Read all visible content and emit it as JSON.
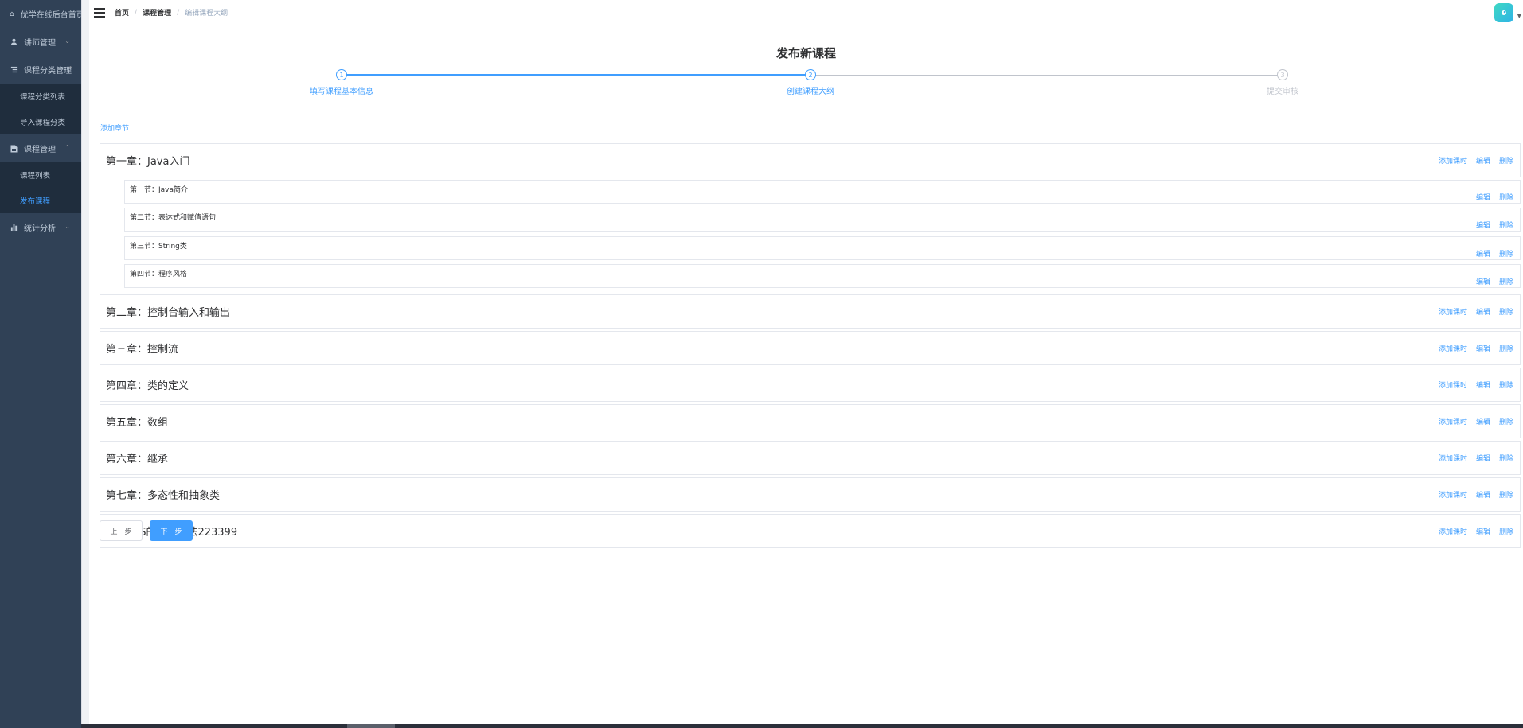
{
  "sidebar": {
    "items": [
      {
        "label": "优学在线后台首页",
        "icon": "home-icon"
      },
      {
        "label": "讲师管理",
        "icon": "user-icon"
      },
      {
        "label": "课程分类管理",
        "icon": "list-icon"
      },
      {
        "label": "课程管理",
        "icon": "document-icon"
      },
      {
        "label": "统计分析",
        "icon": "bar-chart-icon"
      }
    ],
    "category_sub": [
      "课程分类列表",
      "导入课程分类"
    ],
    "course_sub": [
      "课程列表",
      "发布课程"
    ]
  },
  "breadcrumb": [
    "首页",
    "课程管理",
    "编辑课程大纲"
  ],
  "page_title": "发布新课程",
  "steps": [
    {
      "num": "1",
      "label": "填写课程基本信息",
      "status": "done"
    },
    {
      "num": "2",
      "label": "创建课程大纲",
      "status": "active"
    },
    {
      "num": "3",
      "label": "提交审核",
      "status": "wait"
    }
  ],
  "add_chapter": "添加章节",
  "actions": {
    "add_lesson": "添加课时",
    "edit": "编辑",
    "delete": "删除"
  },
  "chapters": [
    {
      "title": "第一章：Java入门"
    },
    {
      "title": "第二章：控制台输入和输出"
    },
    {
      "title": "第三章：控制流"
    },
    {
      "title": "第四章：类的定义"
    },
    {
      "title": "第五章：数组"
    },
    {
      "title": "第六章：继承"
    },
    {
      "title": "第七章：多态性和抽象类"
    },
    {
      "title": "第n章 JS的基本语法223399"
    }
  ],
  "sections": [
    {
      "title": "第一节：Java简介"
    },
    {
      "title": "第二节：表达式和赋值语句"
    },
    {
      "title": "第三节：String类"
    },
    {
      "title": "第四节：程序风格"
    }
  ],
  "buttons": {
    "prev": "上一步",
    "next": "下一步"
  },
  "colors": {
    "sidebar": "#304156",
    "accent": "#409eff"
  }
}
